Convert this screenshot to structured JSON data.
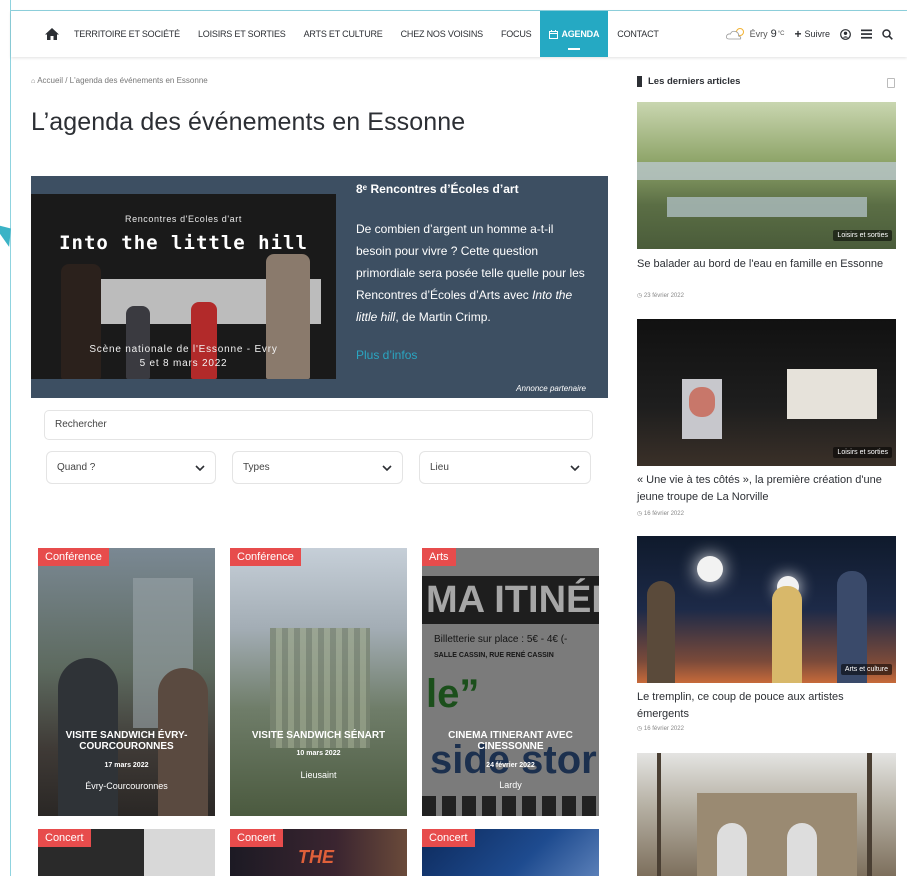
{
  "nav": {
    "items": [
      "Territoire et société",
      "Loisirs et sorties",
      "Arts et culture",
      "Chez nos voisins",
      "Focus",
      "Agenda",
      "Contact"
    ],
    "active_index": 5,
    "weather_city": "Évry",
    "weather_temp": "9",
    "weather_unit": "°C",
    "follow_label": "Suivre"
  },
  "breadcrumb": "Accueil / L'agenda des événements en Essonne",
  "page_title": "L’agenda des événements en Essonne",
  "promo": {
    "image_subtitle": "Rencontres d'Ecoles d'art",
    "image_title": "Into the little hill",
    "image_bottom_line1": "Scène nationale de l'Essonne - Evry",
    "image_bottom_line2": "5 et 8 mars 2022",
    "title": "8ᵉ Rencontres d’Écoles d’art",
    "text_before": "De combien d’argent un homme a-t-il besoin pour vivre ? Cette question primordiale sera posée telle quelle pour les Rencontres d’Écoles d’Arts avec ",
    "text_italic": "Into the little hill",
    "text_after": ", de Martin Crimp.",
    "link": "Plus d’infos",
    "ad_label": "Annonce partenaire"
  },
  "search": {
    "placeholder": "Rechercher"
  },
  "filters": [
    "Quand ?",
    "Types",
    "Lieu"
  ],
  "events": [
    {
      "tag": "Conférence",
      "title": "Visite sandwich Évry-Courcouronnes",
      "date": "17 mars 2022",
      "place": "Évry-Courcouronnes"
    },
    {
      "tag": "Conférence",
      "title": "Visite sandwich Sénart",
      "date": "10 mars 2022",
      "place": "Lieusaint"
    },
    {
      "tag": "Arts",
      "title": "Cinema itinerant avec Cinessonne",
      "date": "24 février 2022",
      "place": "Lardy",
      "poster_line1": "MA ITINÉR",
      "poster_line2": "Billetterie sur place : 5€ - 4€ (-",
      "poster_line3": "SALLE CASSIN, RUE RENÉ CASSIN",
      "poster_line4": "le”",
      "poster_line5": "side stor"
    },
    {
      "tag": "Concert"
    },
    {
      "tag": "Concert",
      "poster_text": "THE"
    },
    {
      "tag": "Concert"
    }
  ],
  "sidebar": {
    "heading": "Les derniers articles",
    "articles": [
      {
        "badge": "Loisirs et sorties",
        "title": "Se balader au bord de l'eau en famille en Essonne",
        "date": "23 février 2022"
      },
      {
        "badge": "Loisirs et sorties",
        "title": "« Une vie à tes côtés », la première création d'une jeune troupe de La Norville",
        "date": "16 février 2022"
      },
      {
        "badge": "Arts et culture",
        "title": "Le tremplin, ce coup de pouce aux artistes émergents",
        "date": "16 février 2022"
      },
      {
        "badge": "",
        "title": "",
        "date": ""
      }
    ]
  },
  "colors": {
    "accent": "#25a9c3",
    "tag_red": "#e74c4c",
    "promo_bg": "#3d4f62"
  }
}
